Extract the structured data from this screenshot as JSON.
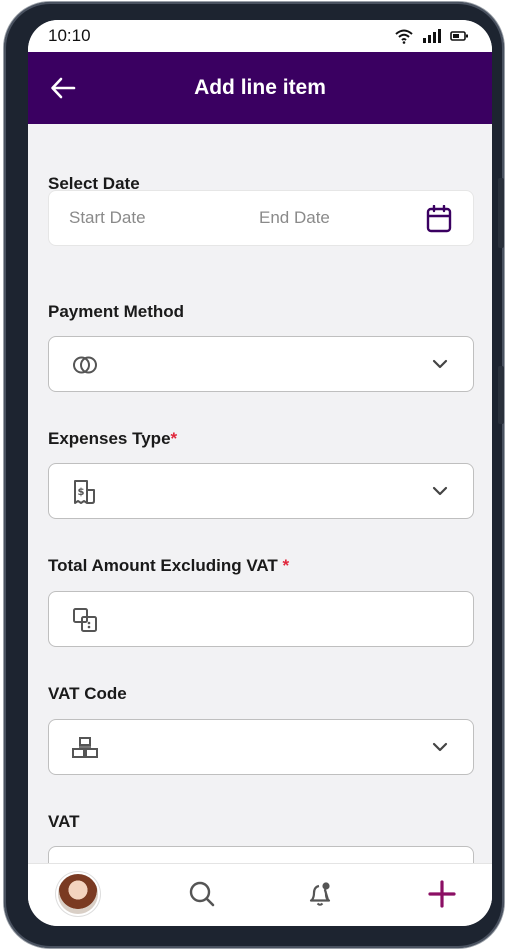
{
  "status": {
    "time": "10:10"
  },
  "header": {
    "title": "Add line item"
  },
  "form": {
    "select_date": {
      "label": "Select Date",
      "start_placeholder": "Start Date",
      "end_placeholder": "End Date"
    },
    "payment_method": {
      "label": "Payment Method",
      "value": ""
    },
    "expenses_type": {
      "label": "Expenses Type",
      "required_mark": "*",
      "value": ""
    },
    "total_amount": {
      "label": "Total Amount Excluding VAT ",
      "required_mark": "*",
      "value": ""
    },
    "vat_code": {
      "label": "VAT Code",
      "value": ""
    },
    "vat": {
      "label": "VAT",
      "value": ""
    }
  },
  "colors": {
    "header_bg": "#3a0061",
    "accent": "#8b0f64",
    "required": "#e0253a"
  }
}
